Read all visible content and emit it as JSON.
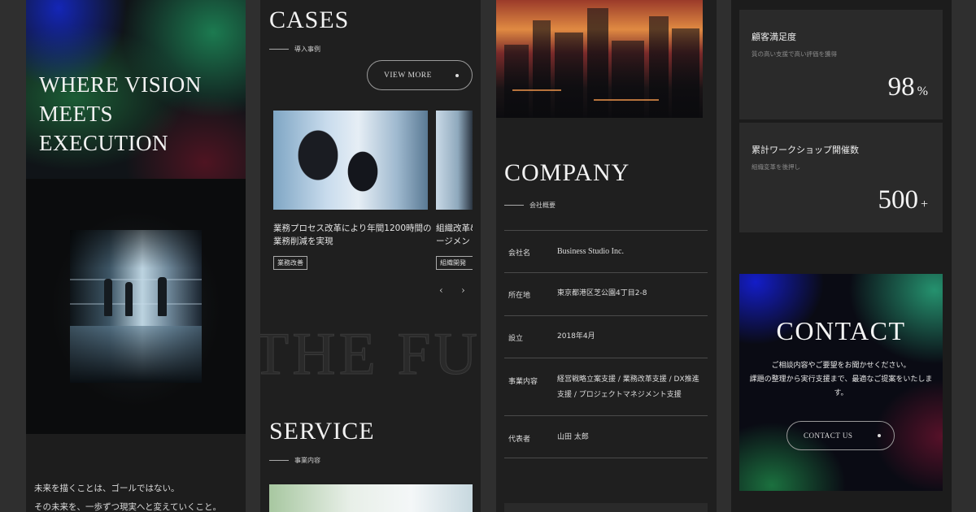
{
  "hero": {
    "title_lines": [
      "WHERE VISION",
      "MEETS",
      "EXECUTION"
    ],
    "intro_lines": [
      "未来を描くことは、ゴールではない。",
      "その未来を、一歩ずつ現実へと変えていくこと。"
    ]
  },
  "cases": {
    "title": "CASES",
    "subtitle": "導入事例",
    "view_more": "VIEW MORE",
    "items": [
      {
        "text_line1": "業務プロセス改革により年間1200時間の",
        "text_line2": "業務削減を実現",
        "tag": "業務改善"
      },
      {
        "text_line1": "組織改革&",
        "text_line2": "ージメン",
        "tag": "組織開発"
      }
    ],
    "prev": "‹",
    "next": "›"
  },
  "watermark": "THE FUT",
  "service": {
    "title": "SERVICE",
    "subtitle": "事業内容"
  },
  "company": {
    "title": "COMPANY",
    "subtitle": "会社概要",
    "rows": [
      {
        "key": "会社名",
        "value_line1": "Business Studio Inc.",
        "value_line2": ""
      },
      {
        "key": "所在地",
        "value_line1": "東京都港区芝公園4丁目2-8",
        "value_line2": ""
      },
      {
        "key": "設立",
        "value_line1": "2018年4月",
        "value_line2": ""
      },
      {
        "key": "事業内容",
        "value_line1": "経営戦略立案支援 / 業務改革支援 / DX推進",
        "value_line2": "支援 / プロジェクトマネジメント支援"
      },
      {
        "key": "代表者",
        "value_line1": "山田 太郎",
        "value_line2": ""
      }
    ]
  },
  "stats": [
    {
      "title": "顧客満足度",
      "desc": "質の高い支援で高い評価を獲得",
      "number": "98",
      "unit": "%"
    },
    {
      "title": "累計ワークショップ開催数",
      "desc": "組織変革を後押し",
      "number": "500",
      "unit": "+"
    }
  ],
  "contact": {
    "title": "CONTACT",
    "desc_lines": [
      "ご相談内容やご要望をお聞かせください。",
      "課題の整理から実行支援まで、最適なご提案をいたしま",
      "す。"
    ],
    "button": "CONTACT US"
  }
}
